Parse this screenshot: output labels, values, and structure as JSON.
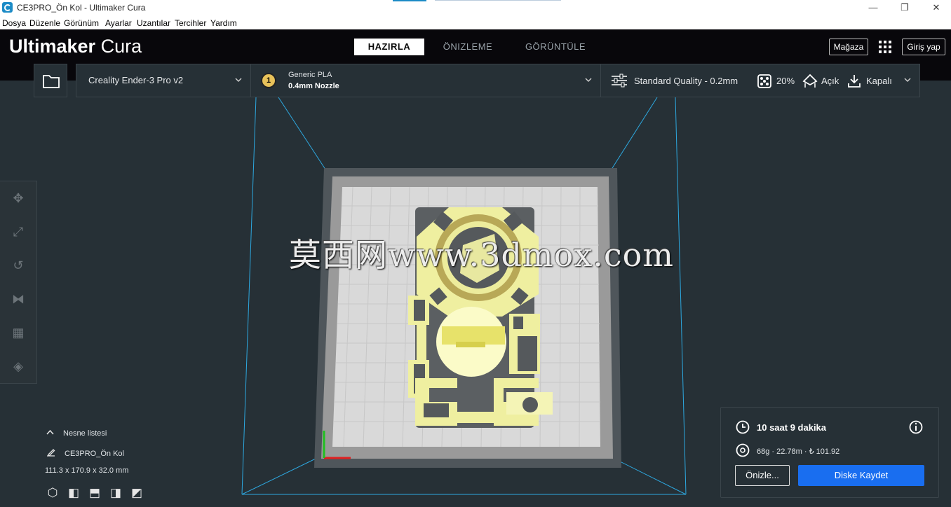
{
  "window": {
    "title": "CE3PRO_Ön Kol - Ultimaker Cura",
    "minimize": "—",
    "restore": "❐",
    "close": "✕"
  },
  "menu": [
    "Dosya",
    "Düzenle",
    "Görünüm",
    "Ayarlar",
    "Uzantılar",
    "Tercihler",
    "Yardım"
  ],
  "header": {
    "logo_bold": "Ultimaker",
    "logo_light": "Cura",
    "stages": [
      {
        "label": "HAZIRLA",
        "active": true
      },
      {
        "label": "ÖNIZLEME",
        "active": false
      },
      {
        "label": "GÖRÜNTÜLE",
        "active": false
      }
    ],
    "marketplace": "Mağaza",
    "signin": "Giriş yap"
  },
  "printer": {
    "name": "Creality Ender-3 Pro v2"
  },
  "material": {
    "extruder": "1",
    "name": "Generic PLA",
    "nozzle": "0.4mm Nozzle"
  },
  "settings": {
    "profile": "Standard Quality - 0.2mm",
    "infill": "20%",
    "support": "Açık",
    "adhesion": "Kapalı"
  },
  "object_list": {
    "header": "Nesne listesi",
    "object_name": "CE3PRO_Ön Kol",
    "dimensions": "111.3 x 170.9 x 32.0 mm"
  },
  "print_info": {
    "time": "10 saat 9 dakika",
    "material_usage": "68g · 22.78m · ₺ 101.92",
    "preview_button": "Önizle...",
    "save_button": "Diske Kaydet"
  },
  "watermark": "莫西网www.3dmox.com",
  "colors": {
    "header_bg": "#08070b",
    "viewport_bg": "#263036",
    "accent": "#196ef0",
    "model": "#f2f29c",
    "build_volume_line": "#2da8e0"
  }
}
